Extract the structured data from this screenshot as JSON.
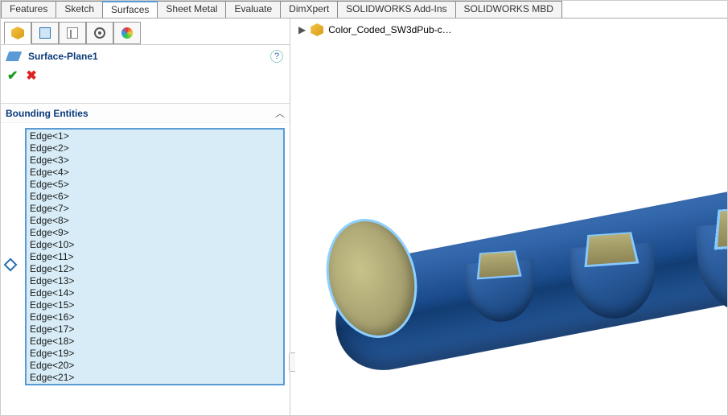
{
  "tabs": [
    "Features",
    "Sketch",
    "Surfaces",
    "Sheet Metal",
    "Evaluate",
    "DimXpert",
    "SOLIDWORKS Add-Ins",
    "SOLIDWORKS MBD"
  ],
  "active_tab_index": 2,
  "pm_tabs": [
    "cube",
    "sheet",
    "tree",
    "target",
    "sphere"
  ],
  "pm_active_index": 0,
  "feature": {
    "name": "Surface-Plane1"
  },
  "section": {
    "title": "Bounding Entities"
  },
  "edges": [
    "Edge<1>",
    "Edge<2>",
    "Edge<3>",
    "Edge<4>",
    "Edge<5>",
    "Edge<6>",
    "Edge<7>",
    "Edge<8>",
    "Edge<9>",
    "Edge<10>",
    "Edge<11>",
    "Edge<12>",
    "Edge<13>",
    "Edge<14>",
    "Edge<15>",
    "Edge<16>",
    "Edge<17>",
    "Edge<18>",
    "Edge<19>",
    "Edge<20>",
    "Edge<21>"
  ],
  "breadcrumb": {
    "label": "Color_Coded_SW3dPub-c…"
  }
}
